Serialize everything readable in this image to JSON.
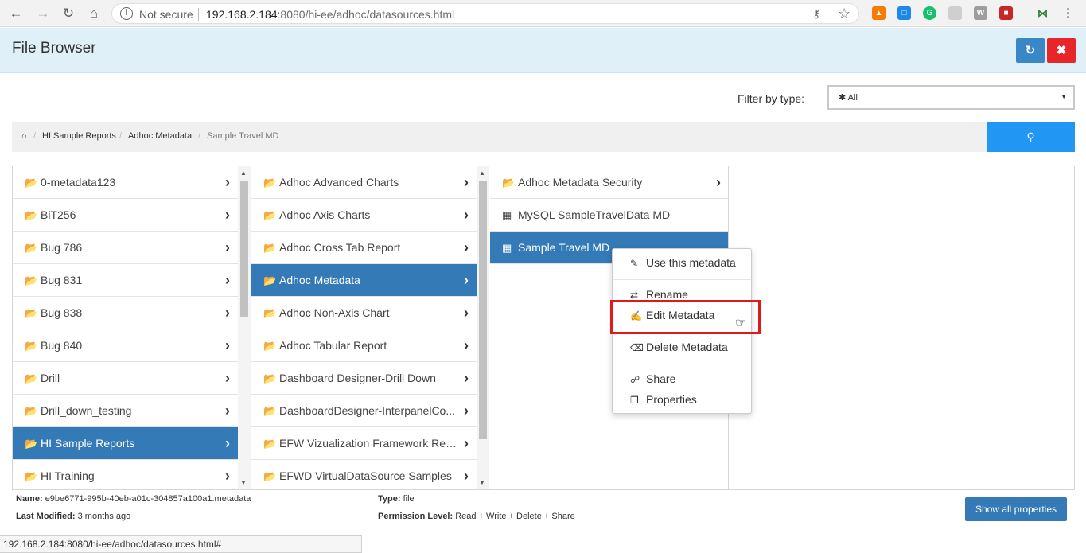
{
  "browser": {
    "secure_text": "Not secure",
    "url_host": "192.168.2.184",
    "url_rest": ":8080/hi-ee/adhoc/datasources.html",
    "status_url": "192.168.2.184:8080/hi-ee/adhoc/datasources.html#"
  },
  "header": {
    "title": "File Browser"
  },
  "filter": {
    "label": "Filter by type:",
    "value": "All"
  },
  "breadcrumb": {
    "items": [
      "HI Sample Reports",
      "Adhoc Metadata",
      "Sample Travel MD"
    ]
  },
  "columns": {
    "col1": [
      {
        "label": "0-metadata123"
      },
      {
        "label": "BiT256"
      },
      {
        "label": "Bug 786"
      },
      {
        "label": "Bug 831"
      },
      {
        "label": "Bug 838"
      },
      {
        "label": "Bug 840"
      },
      {
        "label": "Drill"
      },
      {
        "label": "Drill_down_testing"
      },
      {
        "label": "HI Sample Reports"
      },
      {
        "label": "HI Training"
      }
    ],
    "col2": [
      {
        "label": "Adhoc Advanced Charts"
      },
      {
        "label": "Adhoc Axis Charts"
      },
      {
        "label": "Adhoc Cross Tab Report"
      },
      {
        "label": "Adhoc Metadata"
      },
      {
        "label": "Adhoc Non-Axis Chart"
      },
      {
        "label": "Adhoc Tabular Report"
      },
      {
        "label": "Dashboard Designer-Drill Down"
      },
      {
        "label": "DashboardDesigner-InterpanelCo..."
      },
      {
        "label": "EFW Vizualization Framework Rep..."
      },
      {
        "label": "EFWD VirtualDataSource Samples"
      }
    ],
    "col3": [
      {
        "label": "Adhoc Metadata Security"
      },
      {
        "label": "MySQL SampleTravelData MD"
      },
      {
        "label": "Sample Travel MD"
      }
    ]
  },
  "context_menu": {
    "use": "Use this metadata",
    "rename": "Rename",
    "edit": "Edit Metadata",
    "delete": "Delete Metadata",
    "share": "Share",
    "properties": "Properties"
  },
  "info": {
    "name_label": "Name:",
    "name_value": "e9be6771-995b-40eb-a01c-304857a100a1.metadata",
    "type_label": "Type:",
    "type_value": "file",
    "modified_label": "Last Modified:",
    "modified_value": "3 months ago",
    "permission_label": "Permission Level:",
    "permission_value": "Read + Write + Delete + Share",
    "show_all": "Show all properties"
  },
  "colors": {
    "header_bg": "#dff0f8",
    "selected": "#337ab7",
    "search": "#2196f3",
    "close": "#e8262a",
    "highlight": "#e01a1a"
  }
}
